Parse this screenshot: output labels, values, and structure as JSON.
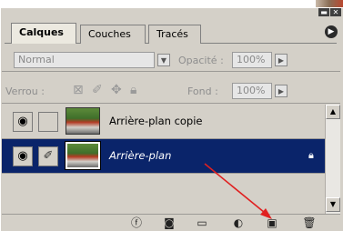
{
  "tabs": [
    {
      "label": "Calques",
      "active": true
    },
    {
      "label": "Couches",
      "active": false
    },
    {
      "label": "Tracés",
      "active": false
    }
  ],
  "window_buttons": {
    "minimize": "▬",
    "close": "✕"
  },
  "panel_menu_glyph": "▶",
  "blend_mode": {
    "value": "Normal"
  },
  "opacity": {
    "label": "Opacité :",
    "value": "100%"
  },
  "lock": {
    "label": "Verrou :"
  },
  "fill": {
    "label": "Fond :",
    "value": "100%"
  },
  "layers": [
    {
      "name": "Arrière-plan copie",
      "selected": false,
      "locked": false
    },
    {
      "name": "Arrière-plan",
      "selected": true,
      "locked": true
    }
  ],
  "bottom_icons": [
    "link-layers-icon",
    "layer-style-icon",
    "layer-mask-icon",
    "new-group-icon",
    "adjustment-layer-icon",
    "new-layer-icon",
    "trash-icon"
  ],
  "colors": {
    "selection": "#0a246a",
    "annotation_arrow": "#e02020",
    "panel": "#d4d0c8"
  }
}
